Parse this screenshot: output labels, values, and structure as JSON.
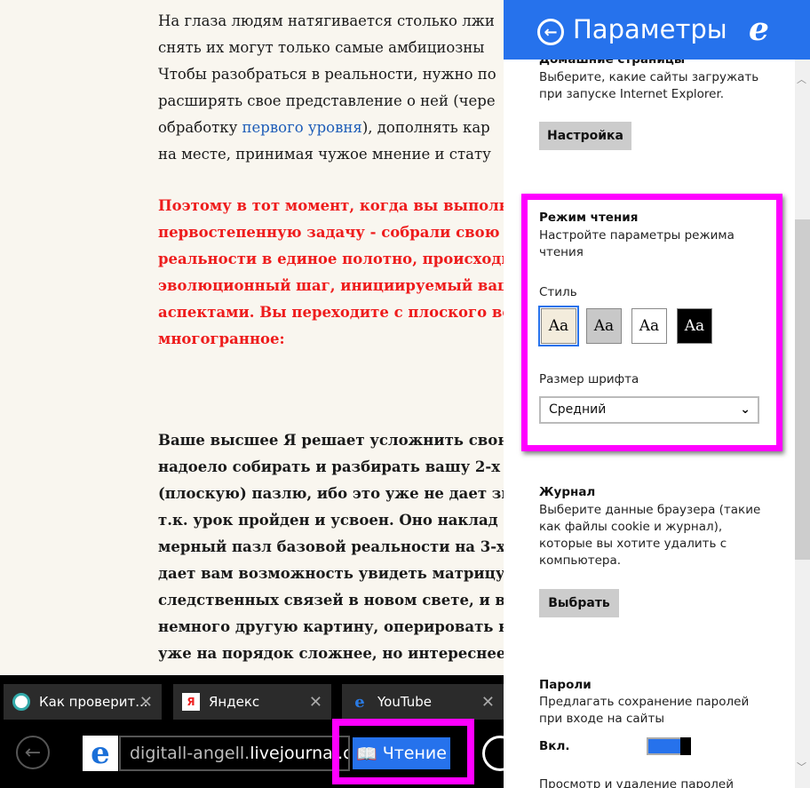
{
  "article": {
    "para1": [
      "На глаза людям натягивается столько лжи",
      "снять их могут только самые амбициозны",
      "Чтобы разобраться в реальности, нужно по",
      "расширять свое представление о ней (чере",
      {
        "before": "обработку ",
        "link": "первого уровня",
        "after": "), дополнять кар"
      },
      "на месте, принимая чужое мнение и стату"
    ],
    "para2": [
      "Поэтому в тот момент, когда вы выполн",
      "первостепенную задачу - собрали свою б",
      "реальности в единое полотно, происходи",
      "эволюционный шаг, инициируемый ваш",
      "аспектами. Вы переходите с плоского во",
      "многогранное:"
    ],
    "para3": [
      "Ваше высшее Я решает усложнить свою",
      "надоело собирать и разбирать вашу 2-х",
      "(плоскую) пазлю, ибо это уже не дает зн",
      "т.к. урок пройден и усвоен.  Оно наклад",
      "мерный пазл базовой реальности на 3-х",
      "дает вам возможность увидеть матрицу",
      "следственных связей в новом свете, и вы",
      "немного другую картину, оперировать к",
      "уже на порядок сложнее, но интереснее"
    ]
  },
  "tabs": [
    {
      "title": "Как проверит...",
      "icon": "site-icon"
    },
    {
      "title": "Яндекс",
      "icon": "yandex-icon"
    },
    {
      "title": "YouTube",
      "icon": "ie-icon"
    }
  ],
  "address": {
    "url_prefix": "digitall-angell.",
    "url_main": "livejournal.c",
    "reading_label": "Чтение"
  },
  "settings": {
    "title": "Параметры",
    "home": {
      "heading": "Домашние страницы",
      "desc": [
        "Выберите, какие сайты загружать",
        "при запуске Internet Explorer."
      ],
      "button": "Настройка"
    },
    "reading": {
      "heading": "Режим чтения",
      "desc": [
        "Настройте параметры режима",
        "чтения"
      ],
      "style_label": "Стиль",
      "swatch_text": "Aa",
      "styles": [
        {
          "bg": "#f3ecdc",
          "fg": "#000"
        },
        {
          "bg": "#c8c8c8",
          "fg": "#000"
        },
        {
          "bg": "#ffffff",
          "fg": "#000"
        },
        {
          "bg": "#000000",
          "fg": "#fff"
        }
      ],
      "selected_style": 0,
      "font_label": "Размер шрифта",
      "font_value": "Средний"
    },
    "journal": {
      "heading": "Журнал",
      "desc": [
        "Выберите данные браузера (такие",
        "как файлы cookie и журнал),",
        "которые вы хотите удалить с",
        "компьютера."
      ],
      "button": "Выбрать"
    },
    "passwords": {
      "heading": "Пароли",
      "desc": [
        "Предлагать сохранение паролей",
        "при входе на сайты"
      ],
      "toggle_label": "Вкл.",
      "toggle_on": true,
      "more": "Просмотр и удаление паролей"
    }
  },
  "colors": {
    "accent": "#2672ec",
    "highlight": "#ff00ff",
    "red_text": "#ee1c1c",
    "page_bg": "#f9f6ef"
  }
}
